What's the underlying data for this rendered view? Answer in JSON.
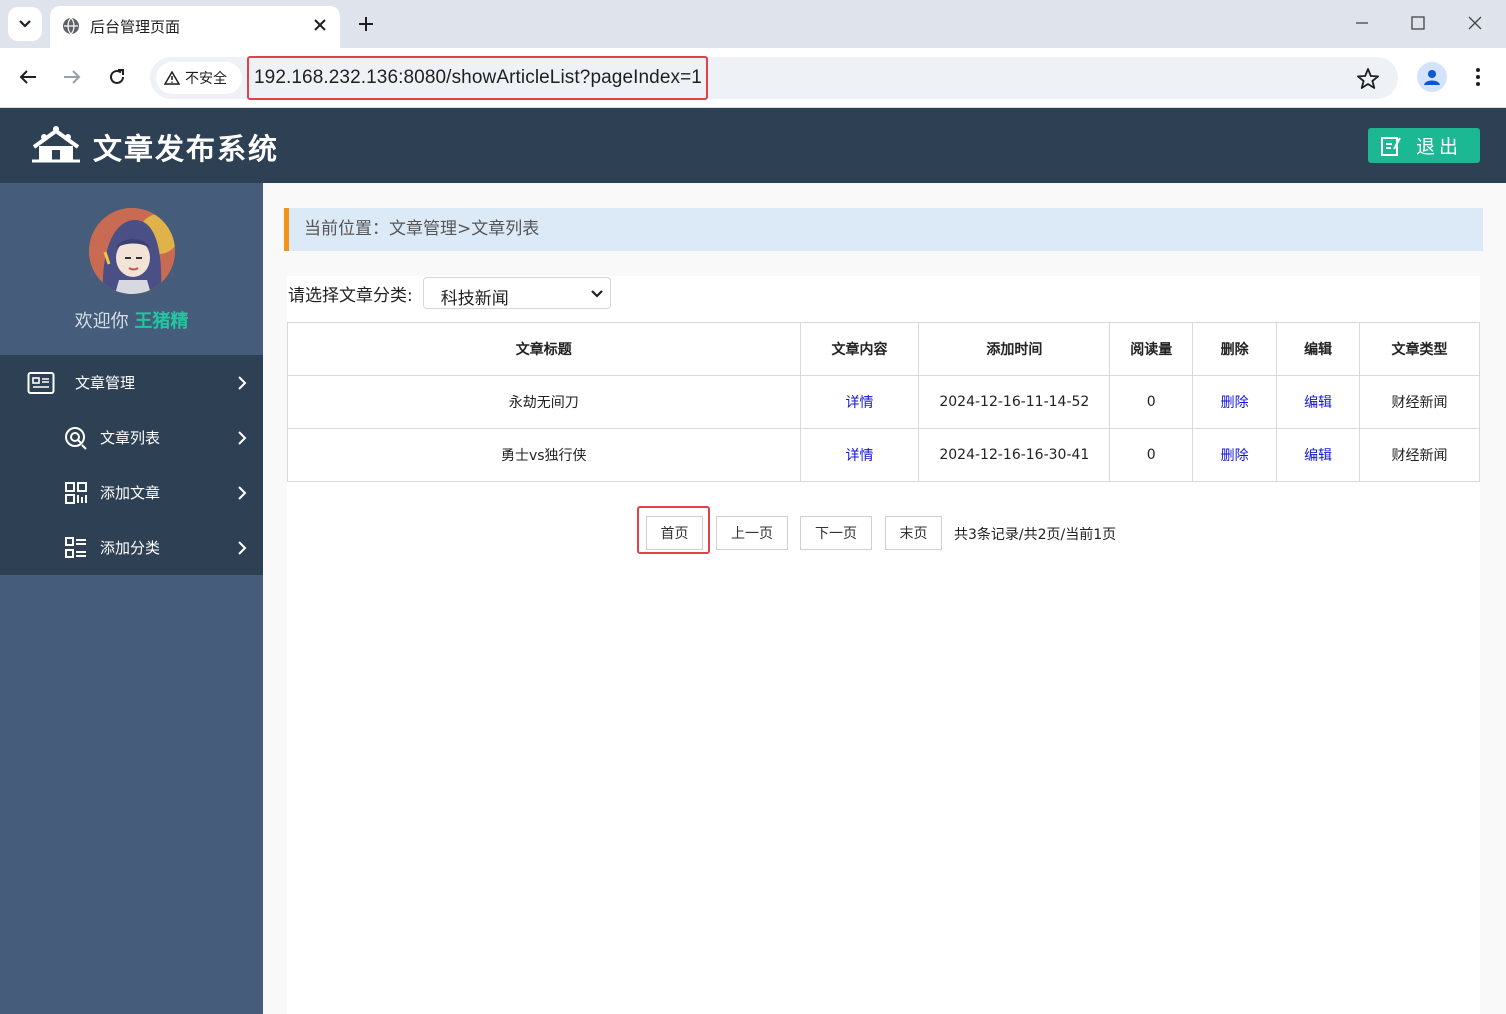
{
  "browser": {
    "tab_title": "后台管理页面",
    "security_label": "不安全",
    "url": "192.168.232.136:8080/showArticleList?pageIndex=1"
  },
  "header": {
    "app_title": "文章发布系统",
    "logout_label": "退出"
  },
  "sidebar": {
    "welcome_prefix": "欢迎你 ",
    "username": "王猪精",
    "menu": [
      {
        "label": "文章管理",
        "icon": "article-card-icon"
      },
      {
        "label": "文章列表",
        "icon": "search-list-icon"
      },
      {
        "label": "添加文章",
        "icon": "grid-add-icon"
      },
      {
        "label": "添加分类",
        "icon": "category-list-icon"
      }
    ]
  },
  "main": {
    "breadcrumb": "当前位置：文章管理>文章列表",
    "category_label": "请选择文章分类:",
    "category_selected": "科技新闻",
    "table": {
      "headers": [
        "文章标题",
        "文章内容",
        "添加时间",
        "阅读量",
        "删除",
        "编辑",
        "文章类型"
      ],
      "rows": [
        {
          "title": "永劫无间刀",
          "content": "详情",
          "time": "2024-12-16-11-14-52",
          "views": "0",
          "delete": "删除",
          "edit": "编辑",
          "type": "财经新闻"
        },
        {
          "title": "勇士vs独行侠",
          "content": "详情",
          "time": "2024-12-16-16-30-41",
          "views": "0",
          "delete": "删除",
          "edit": "编辑",
          "type": "财经新闻"
        }
      ]
    },
    "pager": {
      "first": "首页",
      "prev": "上一页",
      "next": "下一页",
      "last": "末页",
      "info": "共3条记录/共2页/当前1页"
    }
  },
  "colors": {
    "header_bg": "#2d4054",
    "sidebar_bg": "#455d7a",
    "accent_green": "#1cb793",
    "breadcrumb_bg": "#dce9f7",
    "breadcrumb_bar": "#f39318",
    "highlight_red": "#e0424a",
    "link_blue": "#1515d8"
  }
}
